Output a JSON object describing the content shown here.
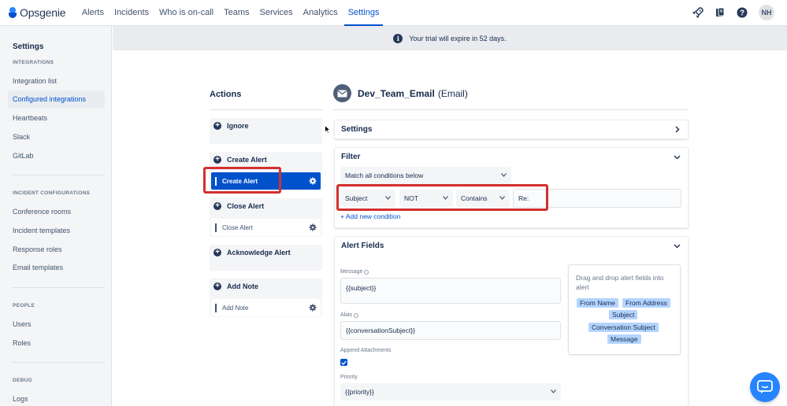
{
  "brand": {
    "name": "Opsgenie"
  },
  "topnav": {
    "items": [
      "Alerts",
      "Incidents",
      "Who is on-call",
      "Teams",
      "Services",
      "Analytics",
      "Settings"
    ],
    "active": "Settings",
    "avatar_initials": "NH"
  },
  "sidebar": {
    "title": "Settings",
    "integrations_heading": "INTEGRATIONS",
    "integrations": [
      "Integration list",
      "Configured integrations",
      "Heartbeats",
      "Slack",
      "GitLab"
    ],
    "incident_heading": "INCIDENT CONFIGURATIONS",
    "incident": [
      "Conference rooms",
      "Incident templates",
      "Response roles",
      "Email templates"
    ],
    "people_heading": "PEOPLE",
    "people": [
      "Users",
      "Roles"
    ],
    "debug_heading": "DEBUG",
    "debug": [
      "Logs"
    ]
  },
  "banner": {
    "text": "Your trial will expire in 52 days."
  },
  "actions": {
    "title": "Actions",
    "ignore": "Ignore",
    "create_alert": "Create Alert",
    "create_alert_item": "Create Alert",
    "close_alert": "Close Alert",
    "close_alert_item": "Close Alert",
    "acknowledge_alert": "Acknowledge Alert",
    "add_note": "Add Note",
    "add_note_item": "Add Note"
  },
  "integration": {
    "name": "Dev_Team_Email",
    "type": "(Email)"
  },
  "settings_card": {
    "title": "Settings"
  },
  "filter": {
    "title": "Filter",
    "match": "Match all conditions below",
    "field": "Subject",
    "negation": "NOT",
    "operator": "Contains",
    "value": "Re:",
    "add_condition": "+ Add new condition"
  },
  "alert_fields": {
    "title": "Alert Fields",
    "message_label": "Message",
    "message_value": "{{subject}}",
    "alias_label": "Alias",
    "alias_value": "{{conversationSubject}}",
    "append_label": "Append Attachments",
    "append_checked": true,
    "priority_label": "Priority",
    "priority_value": "{{priority}}",
    "dnd_text": "Drag and drop alert fields into alert",
    "tags": [
      "From Name",
      "From Address",
      "Subject",
      "Conversation Subject",
      "Message"
    ]
  }
}
